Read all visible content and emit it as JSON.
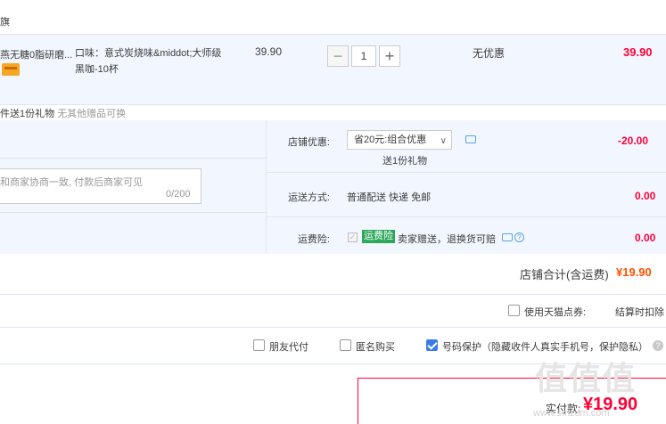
{
  "shop": {
    "name_fragment": "旗"
  },
  "item": {
    "name": "燕无糖0脂研磨...",
    "sku": "口味：意式炭烧味&middot;大师级黑咖-10杯",
    "unit_price": "39.90",
    "quantity": "1",
    "minus": "−",
    "plus": "+",
    "discount": "无优惠",
    "subtotal": "39.90"
  },
  "gift": {
    "text": "件送1份礼物",
    "note": "无其他赠品可换"
  },
  "memo": {
    "placeholder": "和商家协商一致, 付款后商家可见",
    "count": "0/200"
  },
  "coupon": {
    "label": "店铺优惠:",
    "selected": "省20元:组合优惠",
    "arrow": "∨",
    "gift_sub": "送1份礼物",
    "amount": "-20.00"
  },
  "shipping": {
    "label": "运送方式:",
    "value": "普通配送 快递 免邮",
    "amount": "0.00"
  },
  "insurance": {
    "label": "运费险:",
    "badge": "运费险",
    "desc": "卖家赠送，退换货可赔",
    "amount": "0.00",
    "check_mark": "✓",
    "help": "?"
  },
  "shop_total": {
    "label": "店铺合计(含运费)",
    "value": "¥19.90"
  },
  "points": {
    "label": "使用天猫点券:",
    "note": "结算时扣除"
  },
  "options": {
    "friend_pay": "朋友代付",
    "anonymous": "匿名购买",
    "privacy": "号码保护（隐藏收件人真实手机号，保护隐私）",
    "help": "?"
  },
  "payment": {
    "label": "实付款:",
    "value": "¥19.90"
  },
  "watermark": {
    "logo": "值值值",
    "url": "www.smzdm.com"
  },
  "colors": {
    "accent_red": "#ff0036",
    "orange": "#ff5000",
    "panel_bg": "#f2f7ff",
    "checkbox_blue": "#3b7de8"
  }
}
